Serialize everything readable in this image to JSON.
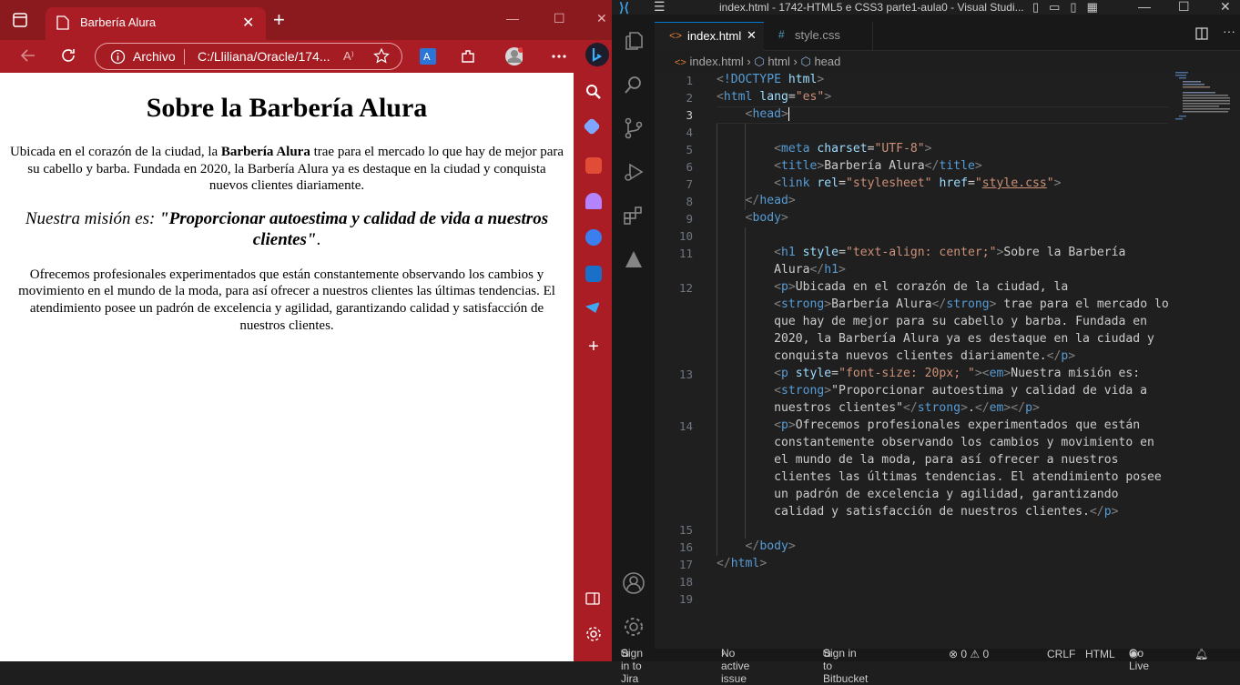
{
  "browser": {
    "tab_title": "Barbería Alura",
    "tab_close": "✕",
    "newtab": "+",
    "address_scheme": "Archivo",
    "address_url": "C:/Lliliana/Oracle/174...",
    "readaloud": "A⁾",
    "window_controls": [
      "—",
      "☐",
      "✕"
    ],
    "brand_color": "#ab1d24"
  },
  "page": {
    "heading": "Sobre la Barbería Alura",
    "p1_before": "Ubicada en el corazón de la ciudad, la ",
    "p1_strong": "Barbería Alura",
    "p1_after": " trae para el mercado lo que hay de mejor para su cabello y barba. Fundada en 2020, la Barbería Alura ya es destaque en la ciudad y conquista nuevos clientes diariamente.",
    "mision_em": "Nuestra misión es: ",
    "mision_strong": "\"Proporcionar autoestima y calidad de vida a nuestros clientes\"",
    "mision_end": ".",
    "p3": "Ofrecemos profesionales experimentados que están constantemente observando los cambios y movimiento en el mundo de la moda, para así ofrecer a nuestros clientes las últimas tendencias. El atendimiento posee un padrón de excelencia y agilidad, garantizando calidad y satisfacción de nuestros clientes."
  },
  "vscode": {
    "window_title": "index.html - 1742-HTML5 e CSS3 parte1-aula0 - Visual Studi...",
    "tabs": [
      {
        "label": "index.html",
        "icon": "html-file-icon",
        "close": "✕"
      },
      {
        "label": "style.css",
        "icon": "css-file-icon"
      }
    ],
    "breadcrumb": [
      "index.html",
      "html",
      "head"
    ],
    "line_numbers": [
      "1",
      "2",
      "3",
      "4",
      "5",
      "6",
      "7",
      "8",
      "9",
      "10",
      "11",
      "12",
      "13",
      "14",
      "15",
      "16",
      "17",
      "18",
      "19"
    ],
    "current_line": "3",
    "status": {
      "jira": "Sign in to Jira",
      "issue": "No active issue",
      "bitbucket": "Sign in to Bitbucket",
      "problems": "⊗ 0 ⚠ 0",
      "eol": "CRLF",
      "lang": "HTML",
      "golive": "Go Live"
    },
    "accent_color": "#0078d4"
  }
}
